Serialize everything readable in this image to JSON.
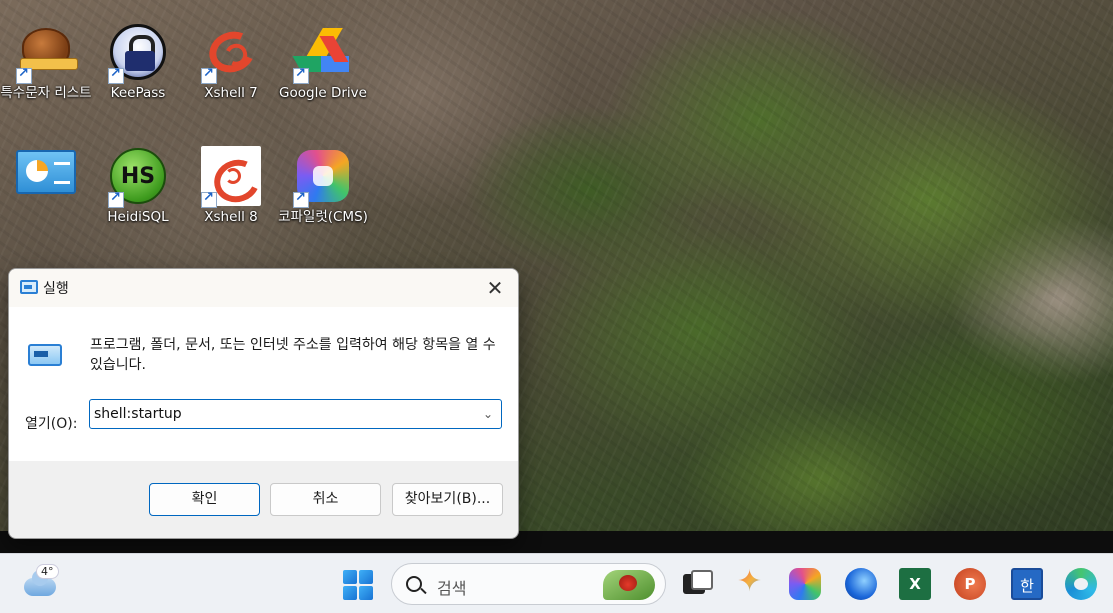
{
  "desktop": {
    "icons": [
      {
        "label": "특수문자 리스트"
      },
      {
        "label": "KeePass"
      },
      {
        "label": "Xshell 7"
      },
      {
        "label": "Google Drive"
      },
      {
        "label": ""
      },
      {
        "label": "HeidiSQL"
      },
      {
        "label": "Xshell 8"
      },
      {
        "label": "코파일럿(CMS)"
      }
    ]
  },
  "run_dialog": {
    "title": "실행",
    "close_glyph": "✕",
    "description": "프로그램, 폴더, 문서, 또는 인터넷 주소를 입력하여 해당 항목을 열 수 있습니다.",
    "open_label": "열기(O):",
    "open_value": "shell:startup",
    "dropdown_glyph": "⌄",
    "ok_label": "확인",
    "cancel_label": "취소",
    "browse_label": "찾아보기(B)..."
  },
  "taskbar": {
    "weather_temp": "4°",
    "search_placeholder": "검색",
    "excel_glyph": "X",
    "ppt_glyph": "P",
    "hwp_glyph": "한"
  },
  "colors": {
    "accent": "#0067c0",
    "taskbar_bg": "#eef1f5",
    "dialog_bg": "#f0f0f0"
  }
}
